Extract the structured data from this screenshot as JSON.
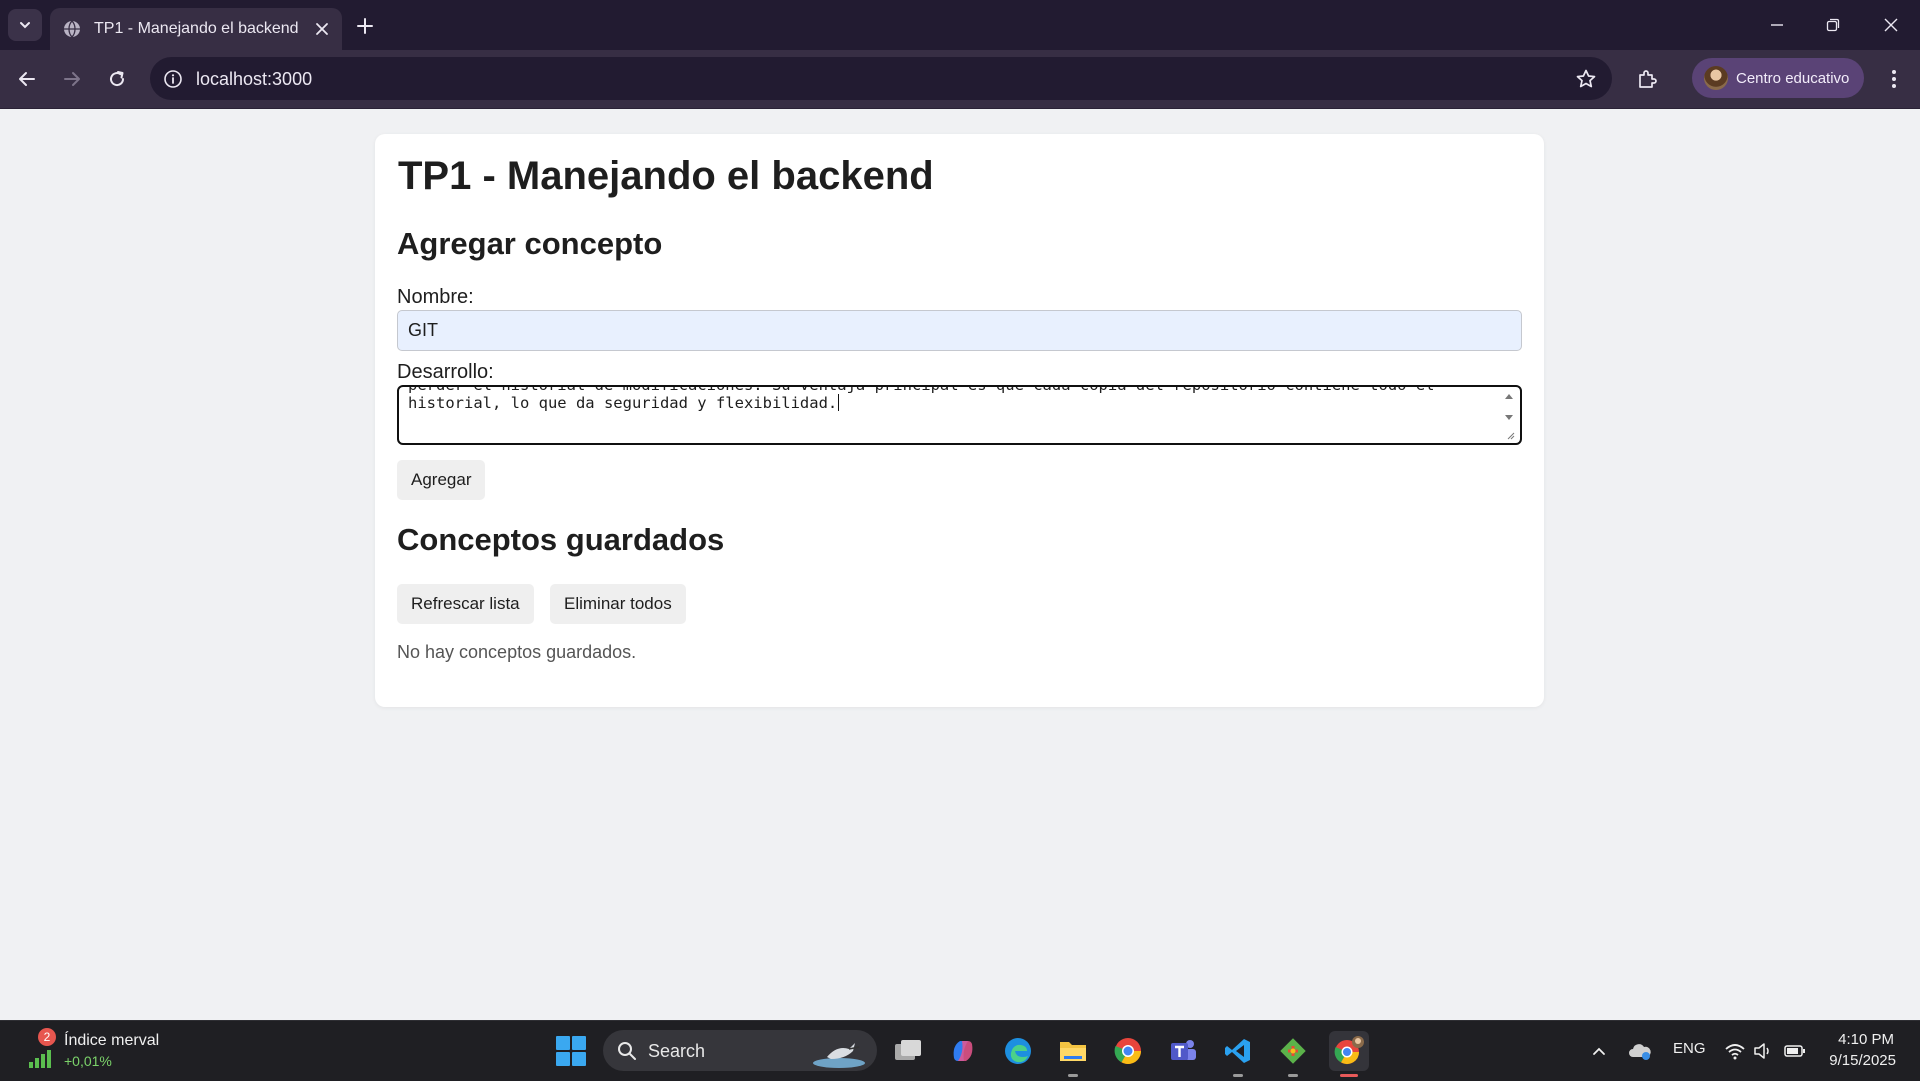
{
  "browser": {
    "tab_title": "TP1 - Manejando el backend",
    "url": "localhost:3000",
    "profile_label": "Centro educativo"
  },
  "page": {
    "title": "TP1 - Manejando el backend",
    "add_section_title": "Agregar concepto",
    "name_label": "Nombre:",
    "name_value": "GIT",
    "dev_label": "Desarrollo:",
    "dev_value_line1": "perder el historial de modificaciones. Su ventaja principal es que cada copia del repositorio contiene todo el",
    "dev_value_line2": "historial, lo que da seguridad y flexibilidad.",
    "add_button": "Agregar",
    "saved_section_title": "Conceptos guardados",
    "refresh_button": "Refrescar lista",
    "delete_all_button": "Eliminar todos",
    "empty_message": "No hay conceptos guardados."
  },
  "taskbar": {
    "widget_badge": "2",
    "widget_title": "Índice merval",
    "widget_value": "+0,01%",
    "search_label": "Search",
    "language": "ENG",
    "time": "4:10 PM",
    "date": "9/15/2025",
    "apps": [
      "task-view",
      "copilot",
      "edge",
      "file-explorer",
      "chrome",
      "teams",
      "vscode",
      "git",
      "chrome-profile"
    ]
  },
  "colors": {
    "chrome_dark": "#221b31",
    "chrome_toolbar": "#372e44",
    "profile_chip": "#5a4376",
    "page_bg": "#f0f1f3",
    "autofill_bg": "#e8f0fe",
    "taskbar_bg": "#1f1f23"
  }
}
